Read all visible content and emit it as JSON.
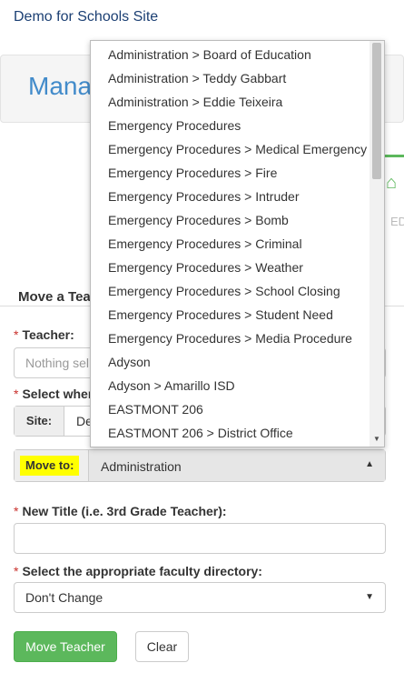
{
  "header": {
    "site_title": "Demo for Schools Site"
  },
  "manage": {
    "title": "Mana"
  },
  "edit_tile": {
    "label": "ED",
    "icon": "home-icon"
  },
  "move_section": {
    "title": "Move a Tea"
  },
  "teacher": {
    "label": "Teacher:",
    "placeholder": "Nothing sel"
  },
  "where": {
    "label": "Select wher",
    "site_label": "Site:",
    "site_value": "De"
  },
  "move_to": {
    "label": "Move to:",
    "value": "Administration"
  },
  "new_title": {
    "label": "New Title (i.e. 3rd Grade Teacher):",
    "value": ""
  },
  "directory": {
    "label": "Select the appropriate faculty directory:",
    "value": "Don't Change"
  },
  "buttons": {
    "move": "Move Teacher",
    "clear": "Clear"
  },
  "dropdown": {
    "items": [
      "Administration > Board of Education",
      "Administration > Teddy Gabbart",
      "Administration > Eddie Teixeira",
      "Emergency Procedures",
      "Emergency Procedures > Medical Emergency",
      "Emergency Procedures > Fire",
      "Emergency Procedures > Intruder",
      "Emergency Procedures > Bomb",
      "Emergency Procedures > Criminal",
      "Emergency Procedures > Weather",
      "Emergency Procedures > School Closing",
      "Emergency Procedures > Student Need",
      "Emergency Procedures > Media Procedure",
      "Adyson",
      "Adyson > Amarillo ISD",
      "EASTMONT 206",
      "EASTMONT 206 > District Office"
    ]
  },
  "colors": {
    "accent": "#428bca",
    "success": "#5cb85c",
    "highlight": "#ffff00",
    "required": "#c9302c"
  }
}
